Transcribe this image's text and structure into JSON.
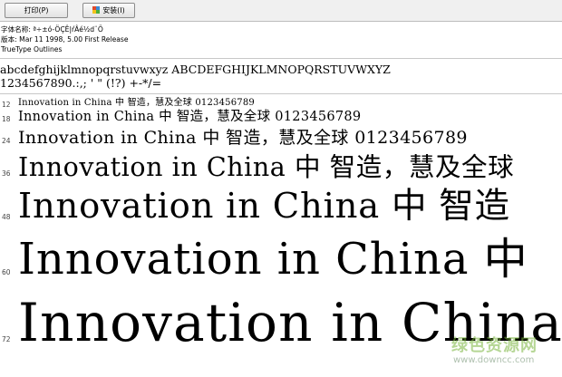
{
  "toolbar": {
    "print_label": "打印(P)",
    "install_label": "安装(I)"
  },
  "info": {
    "font_name": "字体名称: ª÷±ó-ÖÇÊ|ŕÂé½d¨Ö",
    "version": "版本: Mar 11 1998, 5.00 First Release",
    "outline": "TrueType Outlines"
  },
  "charset": {
    "letters": "abcdefghijklmnopqrstuvwxyz ABCDEFGHIJKLMNOPQRSTUVWXYZ",
    "digits": "1234567890.:,; ' \" (!?) +-*/="
  },
  "samples": [
    {
      "size": "12",
      "text": "Innovation in China 中  智造，慧及全球 0123456789"
    },
    {
      "size": "18",
      "text": "Innovation in China 中  智造，慧及全球 0123456789"
    },
    {
      "size": "24",
      "text": "Innovation in China 中  智造，慧及全球 0123456789"
    },
    {
      "size": "36",
      "text": "Innovation in China 中  智造，慧及全球"
    },
    {
      "size": "48",
      "text": "Innovation in China 中  智造"
    },
    {
      "size": "60",
      "text": "Innovation in China 中"
    },
    {
      "size": "72",
      "text": "Innovation in China"
    }
  ],
  "watermark": {
    "logo": "绿色资源网",
    "url": "www.downcc.com"
  },
  "colors": {
    "toolbar_bg": "#f0f0f0",
    "rule": "#c8c8c8",
    "watermark": "#78b43c"
  }
}
